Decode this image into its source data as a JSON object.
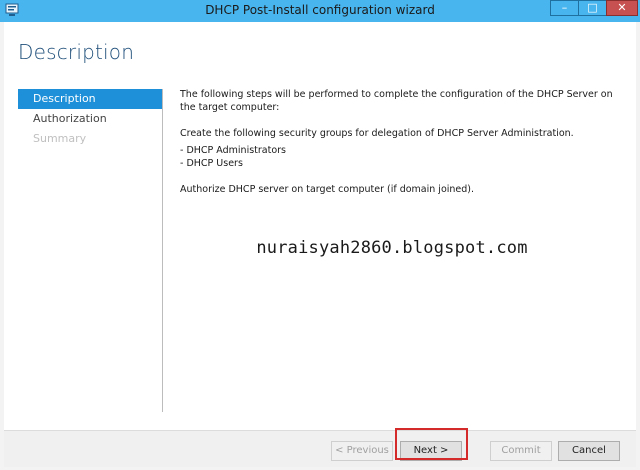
{
  "window": {
    "title": "DHCP Post-Install configuration wizard",
    "app_icon": "server-icon",
    "controls": {
      "minimize": "minimize-icon",
      "maximize": "maximize-icon",
      "close": "close-icon"
    }
  },
  "page": {
    "title": "Description"
  },
  "nav": {
    "items": [
      {
        "label": "Description",
        "state": "active"
      },
      {
        "label": "Authorization",
        "state": "normal"
      },
      {
        "label": "Summary",
        "state": "disabled"
      }
    ]
  },
  "content": {
    "intro": "The following steps will be performed to complete the configuration of the DHCP Server on the target computer:",
    "groups_heading": "Create the following security groups for delegation of DHCP Server Administration.",
    "groups": [
      "- DHCP Administrators",
      "- DHCP Users"
    ],
    "authorize": "Authorize DHCP server on target computer (if domain joined)."
  },
  "watermark": "nuraisyah2860.blogspot.com",
  "buttons": {
    "previous": "< Previous",
    "next": "Next >",
    "commit": "Commit",
    "cancel": "Cancel"
  },
  "colors": {
    "titlebar": "#49b5ee",
    "accent": "#1e90d9",
    "highlight": "#d42a2a"
  }
}
